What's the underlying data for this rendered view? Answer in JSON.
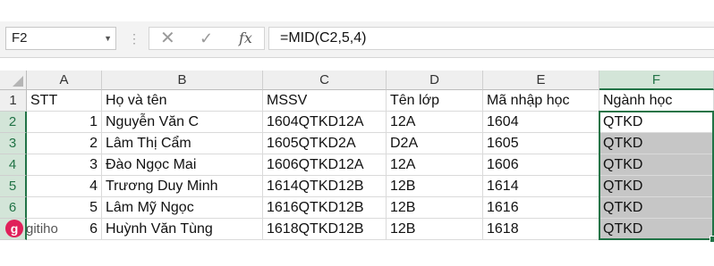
{
  "formula_bar": {
    "name_box": "F2",
    "formula": "=MID(C2,5,4)",
    "icons": [
      "dropdown-arrow-icon",
      "vertical-dots-icon",
      "cancel-x-icon",
      "enter-check-icon",
      "fx-icon"
    ]
  },
  "grid": {
    "columns": [
      "A",
      "B",
      "C",
      "D",
      "E",
      "F"
    ],
    "selected_column": "F",
    "rows": [
      "1",
      "2",
      "3",
      "4",
      "5",
      "6",
      "7"
    ],
    "selected_rows": [
      "2",
      "3",
      "4",
      "5",
      "6",
      "7"
    ],
    "header": [
      "STT",
      "Họ và tên",
      "MSSV",
      "Tên lớp",
      "Mã nhập học",
      "Ngành học"
    ],
    "data": [
      [
        "1",
        "Nguyễn Văn C",
        "1604QTKD12A",
        "12A",
        "1604",
        "QTKD"
      ],
      [
        "2",
        "Lâm Thị Cẩm",
        "1605QTKD2A",
        "D2A",
        "1605",
        "QTKD"
      ],
      [
        "3",
        "Đào Ngọc Mai",
        "1606QTKD12A",
        "12A",
        "1606",
        "QTKD"
      ],
      [
        "4",
        "Trương Duy Minh",
        "1614QTKD12B",
        "12B",
        "1614",
        "QTKD"
      ],
      [
        "5",
        "Lâm Mỹ Ngọc",
        "1616QTKD12B",
        "12B",
        "1616",
        "QTKD"
      ],
      [
        "6",
        "Huỳnh Văn Tùng",
        "1618QTKD12B",
        "12B",
        "1618",
        "QTKD"
      ]
    ]
  },
  "watermark": {
    "letter": "g",
    "text": "gitiho",
    "color": "#e0205a"
  },
  "colors": {
    "selection": "#217346",
    "selection_fill": "#c6c6c6"
  }
}
